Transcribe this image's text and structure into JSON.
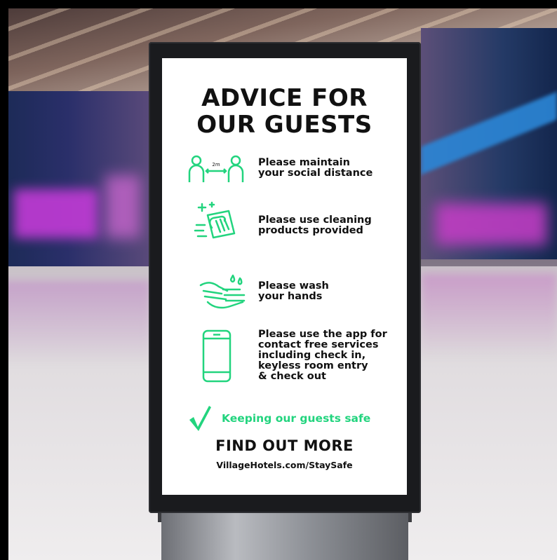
{
  "sign": {
    "title_line1": "ADVICE FOR",
    "title_line2": "OUR GUESTS",
    "items": [
      {
        "icon": "social-distance-icon",
        "distance_label": "2m",
        "lines": [
          "Please maintain",
          "your social distance"
        ]
      },
      {
        "icon": "cleaning-wipe-icon",
        "lines": [
          "Please use cleaning",
          "products provided"
        ]
      },
      {
        "icon": "hand-wash-icon",
        "lines": [
          "Please wash",
          "your hands"
        ]
      },
      {
        "icon": "smartphone-icon",
        "lines": [
          "Please use the app for",
          "contact free services",
          "including check in,",
          "keyless room entry",
          "& check out"
        ]
      }
    ],
    "tagline": "Keeping our guests safe",
    "cta": "FIND OUT MORE",
    "url": "VillageHotels.com/StaySafe"
  },
  "colors": {
    "accent": "#22d47e",
    "text": "#111111",
    "screen": "#ffffff",
    "frame": "#1a1b1e"
  }
}
